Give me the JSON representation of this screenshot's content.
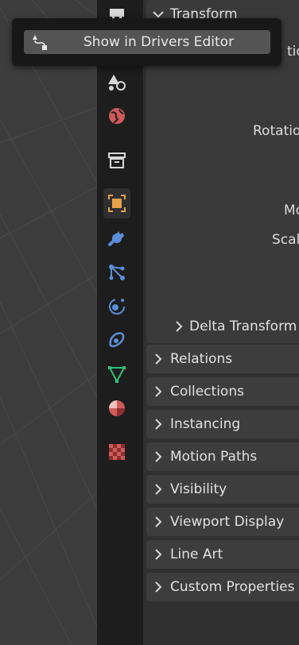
{
  "tooltip": {
    "button_label": "Show in Drivers Editor",
    "icon": "drivers-icon"
  },
  "tabs": [
    {
      "name": "render-icon",
      "active": false
    },
    {
      "name": "physics-scene-icon",
      "active": false
    },
    {
      "name": "world-icon",
      "active": false
    },
    {
      "name": "collection-icon",
      "active": false
    },
    {
      "name": "object-icon",
      "active": true
    },
    {
      "name": "modifier-wrench-icon",
      "active": false
    },
    {
      "name": "particles-icon",
      "active": false
    },
    {
      "name": "physics-icon",
      "active": false
    },
    {
      "name": "constraints-icon",
      "active": false
    },
    {
      "name": "object-data-mesh-icon",
      "active": false
    },
    {
      "name": "material-icon",
      "active": false
    },
    {
      "name": "texture-icon",
      "active": false
    }
  ],
  "transform": {
    "title": "Transform",
    "location_label_partial": "tio",
    "rotation_label": "Rotatio",
    "mode_label_partial": "Mo",
    "scale_label_partial": "Scal",
    "delta_title": "Delta Transform"
  },
  "panels": [
    {
      "label": "Relations"
    },
    {
      "label": "Collections"
    },
    {
      "label": "Instancing"
    },
    {
      "label": "Motion Paths"
    },
    {
      "label": "Visibility"
    },
    {
      "label": "Viewport Display"
    },
    {
      "label": "Line Art"
    },
    {
      "label": "Custom Properties"
    }
  ],
  "colors": {
    "accent_orange": "#e6a24a",
    "wrench_blue": "#5a8fd8",
    "mesh_green": "#2fc07a",
    "world_red": "#d05a5a"
  }
}
